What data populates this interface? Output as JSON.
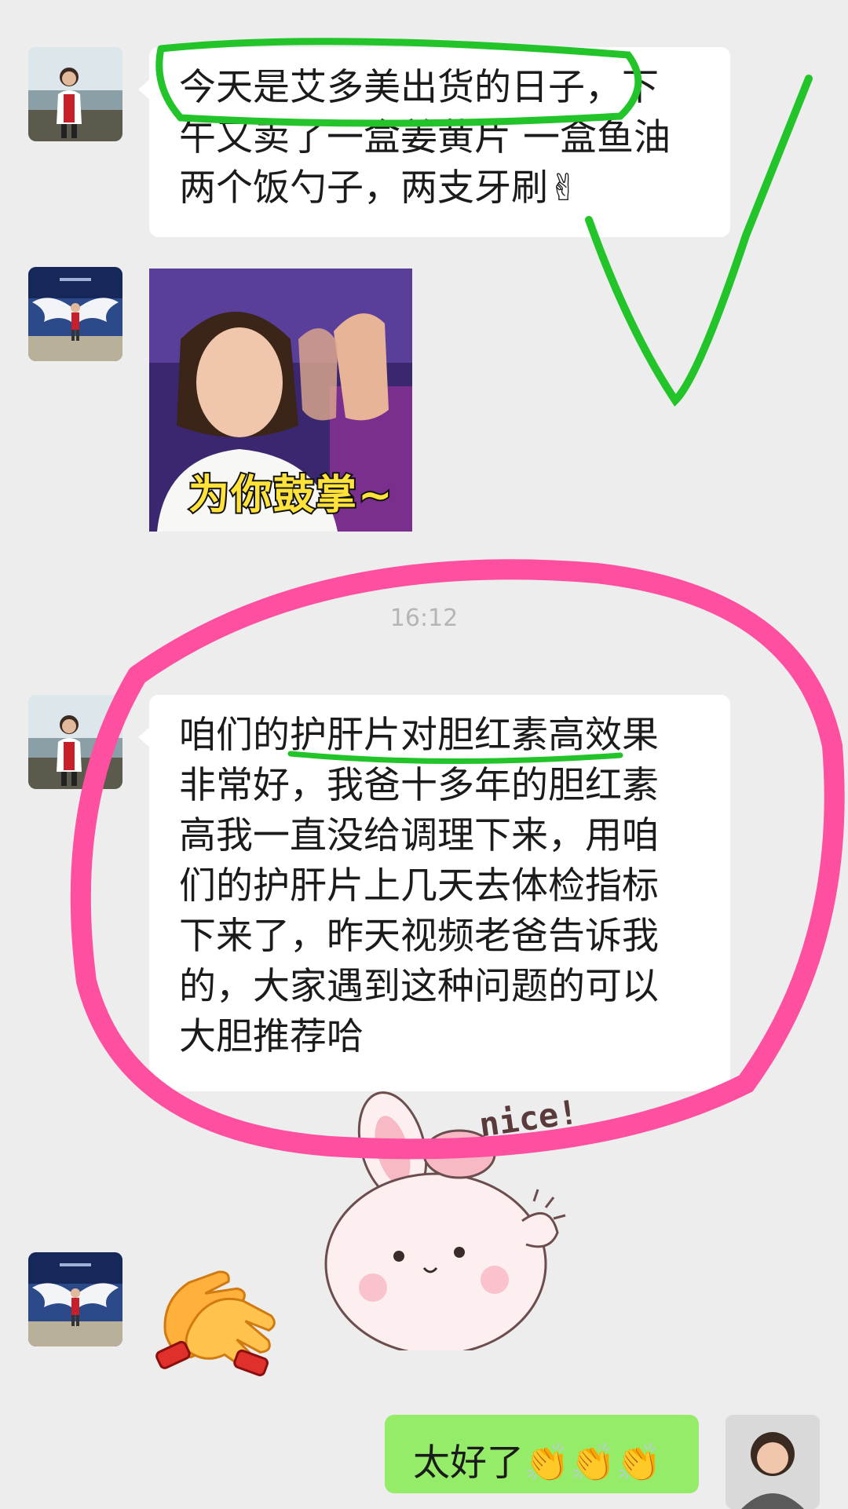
{
  "messages": {
    "msg1": {
      "lines": [
        "今天是艾多美出货的日子，下",
        "午又卖了一盒姜黄片 一盒鱼油",
        "两个饭勺子，两支牙刷✌"
      ]
    },
    "sticker1": {
      "caption": "为你鼓掌~"
    },
    "timestamp": "16:12",
    "msg2": {
      "lines": [
        "咱们的护肝片对胆红素高效果",
        "非常好，我爸十多年的胆红素",
        "高我一直没给调理下来，用咱",
        "们的护肝片上几天去体检指标",
        "下来了，昨天视频老爸告诉我",
        "的，大家遇到这种问题的可以",
        "大胆推荐哈"
      ]
    },
    "outgoing": {
      "text": "太好了👏👏👏"
    }
  },
  "decorations": {
    "nice_sticker_text": "nice!"
  },
  "colors": {
    "background": "#ededed",
    "bubble_incoming": "#ffffff",
    "bubble_outgoing": "#95ec69",
    "annotation_green": "#22c42a",
    "annotation_pink": "#ff4fa0"
  }
}
